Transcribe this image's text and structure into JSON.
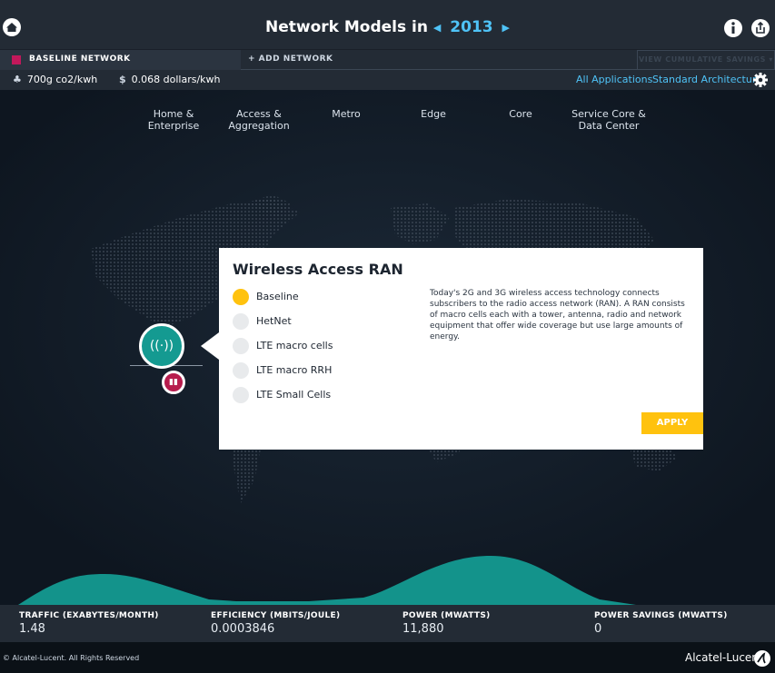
{
  "header": {
    "title_prefix": "Network Models in",
    "year": "2013",
    "prev_symbol": "◀",
    "next_symbol": "▶"
  },
  "networks": {
    "baseline_label": "BASELINE NETWORK",
    "baseline_color": "#c2185b",
    "add_label": "+ ADD NETWORK",
    "cumulative_label": "VIEW CUMULATIVE SAVINGS ▾"
  },
  "metrics": {
    "co2": "700g co2/kwh",
    "cost_symbol": "$",
    "cost": "0.068 dollars/kwh",
    "applications_link": "All Applications",
    "architecture_link": "Standard Architecture"
  },
  "columns": [
    {
      "line1": "Home &",
      "line2": "Enterprise"
    },
    {
      "line1": "Access &",
      "line2": "Aggregation"
    },
    {
      "line1": "Metro",
      "line2": ""
    },
    {
      "line1": "Edge",
      "line2": ""
    },
    {
      "line1": "Core",
      "line2": ""
    },
    {
      "line1": "Service Core &",
      "line2": "Data Center"
    }
  ],
  "node": {
    "main_icon": "wireless-signal-icon",
    "main_glyph": "((·))",
    "small_icon": "building-icon",
    "small_glyph": "▮▮"
  },
  "popup": {
    "title": "Wireless Access RAN",
    "options": [
      {
        "label": "Baseline",
        "selected": true
      },
      {
        "label": "HetNet",
        "selected": false
      },
      {
        "label": "LTE macro cells",
        "selected": false
      },
      {
        "label": "LTE macro RRH",
        "selected": false
      },
      {
        "label": "LTE Small Cells",
        "selected": false
      }
    ],
    "description": "Today's 2G and 3G wireless access technology connects subscribers to the radio access network (RAN). A RAN consists of macro cells each with a tower, antenna, radio and network equipment that offer wide coverage but use large amounts of energy.",
    "apply_label": "APPLY",
    "accent_color": "#ffc20e"
  },
  "stats": [
    {
      "label": "TRAFFIC (EXABYTES/MONTH)",
      "value": "1.48"
    },
    {
      "label": "EFFICIENCY (MBITS/JOULE)",
      "value": "0.0003846"
    },
    {
      "label": "POWER (MWATTS)",
      "value": "11,880"
    },
    {
      "label": "POWER SAVINGS (MWATTS)",
      "value": "0"
    }
  ],
  "footer": {
    "copyright": "© Alcatel-Lucent. All Rights Reserved",
    "brand": "Alcatel-Lucent"
  },
  "colors": {
    "accent_blue": "#4fc3f7",
    "teal": "#149a91",
    "background": "#0e1620"
  }
}
